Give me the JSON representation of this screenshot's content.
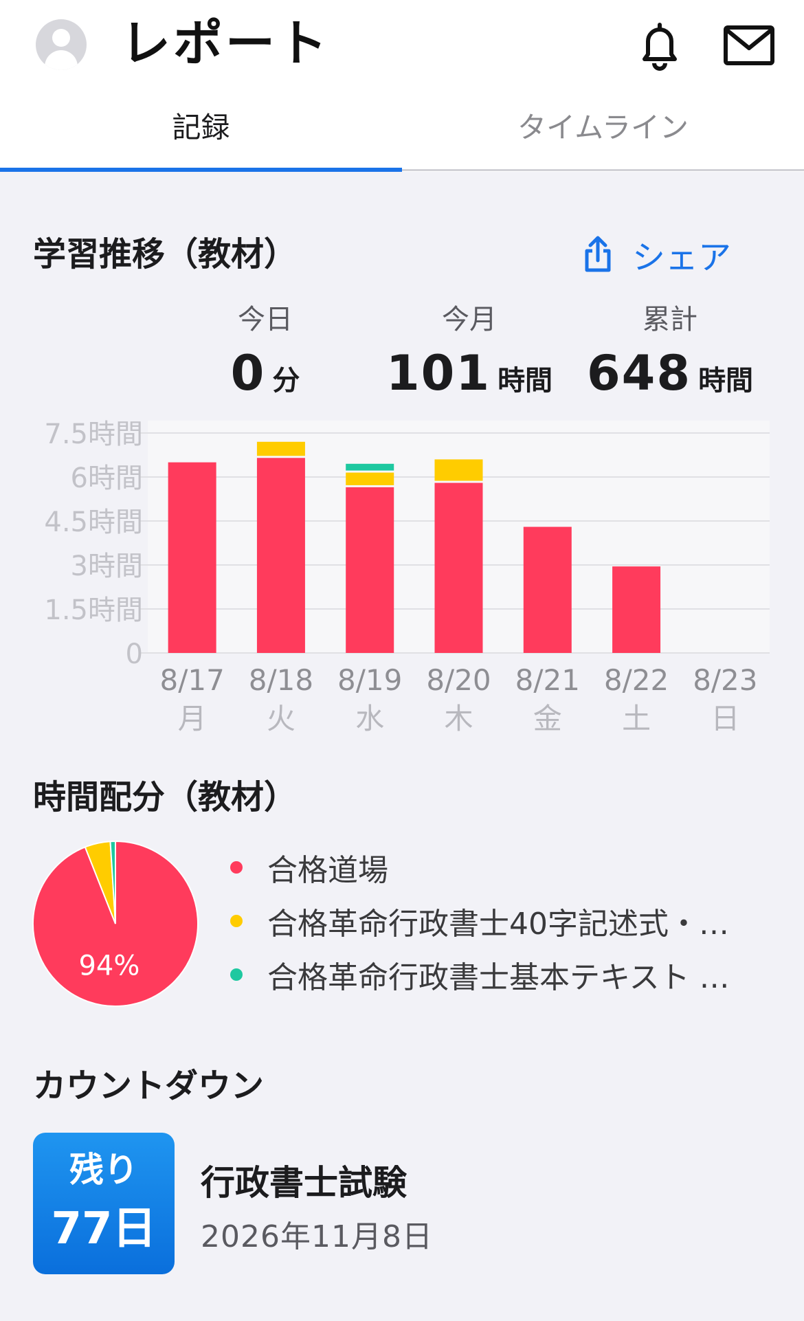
{
  "header": {
    "title": "レポート",
    "icons": {
      "avatar": "user-avatar-icon",
      "bell": "bell-icon",
      "mail": "mail-icon"
    }
  },
  "tabs": [
    {
      "label": "記録",
      "active": true
    },
    {
      "label": "タイムライン",
      "active": false
    }
  ],
  "trend": {
    "title": "学習推移（教材）",
    "share_label": "シェア",
    "share_icon": "share-icon",
    "stats": [
      {
        "label": "今日",
        "value": "0",
        "unit": "分"
      },
      {
        "label": "今月",
        "value": "101",
        "unit": "時間"
      },
      {
        "label": "累計",
        "value": "648",
        "unit": "時間"
      }
    ]
  },
  "allocation": {
    "title": "時間配分（教材）",
    "legend": [
      {
        "label": "合格道場",
        "color": "#ff3b5c"
      },
      {
        "label": "合格革命行政書士40字記述式・…",
        "color": "#ffcc00"
      },
      {
        "label": "合格革命行政書士基本テキスト …",
        "color": "#1ec8a0"
      }
    ]
  },
  "countdown": {
    "title": "カウントダウン",
    "badge_line1": "残り",
    "badge_line2": "77日",
    "exam_name": "行政書士試験",
    "exam_date": "2026年11月8日"
  },
  "colors": {
    "accent": "#1a73e8",
    "series_red": "#ff3b5c",
    "series_yellow": "#ffcc00",
    "series_teal": "#1ec8a0"
  },
  "chart_data": [
    {
      "type": "bar",
      "stacked": true,
      "categories": [
        "8/17",
        "8/18",
        "8/19",
        "8/20",
        "8/21",
        "8/22",
        "8/23"
      ],
      "weekdays": [
        "月",
        "火",
        "水",
        "木",
        "金",
        "土",
        "日"
      ],
      "yticks": [
        "0",
        "1.5時間",
        "3時間",
        "4.5時間",
        "6時間",
        "7.5時間"
      ],
      "ylim": [
        0,
        7.5
      ],
      "grid": true,
      "series": [
        {
          "color": "#ff3b5c",
          "values": [
            6.5,
            6.65,
            5.65,
            5.8,
            4.3,
            2.95,
            0
          ]
        },
        {
          "color": "#ffcc00",
          "values": [
            0,
            0.55,
            0.5,
            0.8,
            0,
            0,
            0
          ]
        },
        {
          "color": "#1ec8a0",
          "values": [
            0,
            0,
            0.3,
            0,
            0,
            0,
            0
          ]
        }
      ]
    },
    {
      "type": "pie",
      "slices": [
        {
          "color": "#ff3b5c",
          "value": 94,
          "label": "94%"
        },
        {
          "color": "#ffcc00",
          "value": 5,
          "label": ""
        },
        {
          "color": "#1ec8a0",
          "value": 1,
          "label": ""
        }
      ]
    }
  ]
}
